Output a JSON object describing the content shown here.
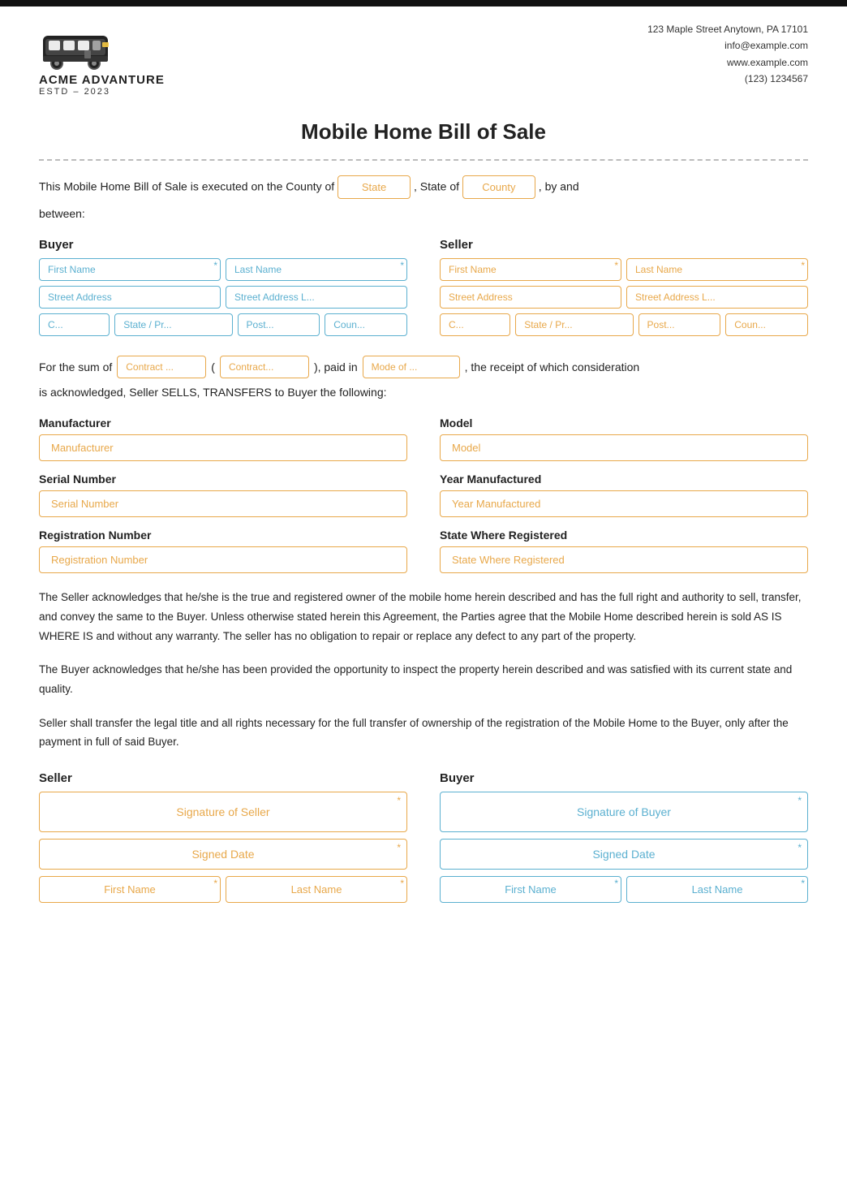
{
  "topbar": {},
  "header": {
    "company_name": "ACME ADVANTURE",
    "company_estd": "ESTD – 2023",
    "contact_address": "123 Maple Street Anytown, PA 17101",
    "contact_email": "info@example.com",
    "contact_website": "www.example.com",
    "contact_phone": "(123) 1234567"
  },
  "document": {
    "title": "Mobile Home Bill of Sale"
  },
  "intro": {
    "text1": "This Mobile Home Bill of Sale is executed on the County of",
    "state_placeholder": "State",
    "text2": ", State of",
    "county_placeholder": "County",
    "text3": ", by and",
    "text4": "between:"
  },
  "buyer": {
    "label": "Buyer",
    "first_name_placeholder": "First Name",
    "last_name_placeholder": "Last Name",
    "street_placeholder": "Street Address",
    "street2_placeholder": "Street Address L...",
    "city_placeholder": "C...",
    "state_placeholder": "State / Pr...",
    "post_placeholder": "Post...",
    "country_placeholder": "Coun..."
  },
  "seller": {
    "label": "Seller",
    "first_name_placeholder": "First Name",
    "last_name_placeholder": "Last Name",
    "street_placeholder": "Street Address",
    "street2_placeholder": "Street Address L...",
    "city_placeholder": "C...",
    "state_placeholder": "State / Pr...",
    "post_placeholder": "Post...",
    "country_placeholder": "Coun..."
  },
  "sum": {
    "text1": "For the sum of",
    "contract1_placeholder": "Contract ...",
    "text2": "(",
    "contract2_placeholder": "Contract...",
    "text3": "), paid in",
    "mode_placeholder": "Mode of ...",
    "text4": ", the receipt of which consideration"
  },
  "ack": {
    "text": "is acknowledged, Seller SELLS, TRANSFERS to Buyer the following:"
  },
  "vehicle": {
    "manufacturer_label": "Manufacturer",
    "manufacturer_placeholder": "Manufacturer",
    "model_label": "Model",
    "model_placeholder": "Model",
    "serial_label": "Serial Number",
    "serial_placeholder": "Serial Number",
    "year_label": "Year Manufactured",
    "year_placeholder": "Year Manufactured",
    "registration_label": "Registration Number",
    "registration_placeholder": "Registration Number",
    "state_reg_label": "State Where Registered",
    "state_reg_placeholder": "State Where Registered"
  },
  "legal": {
    "para1": "The Seller acknowledges that he/she is the true and registered owner of the mobile home herein described and has the full right and authority to sell, transfer, and convey the same to the Buyer. Unless otherwise stated herein this Agreement, the Parties agree that the Mobile Home described herein is sold AS IS WHERE IS and without any warranty. The seller has no obligation to repair or replace any defect to any part of the property.",
    "para2": "The Buyer acknowledges that he/she has been provided the opportunity to inspect the property herein described and was satisfied with its current state and quality.",
    "para3": "Seller shall transfer the legal title and all rights necessary for the full transfer of ownership of the registration of the Mobile Home to the Buyer, only after the payment in full of said Buyer."
  },
  "sig_seller": {
    "label": "Seller",
    "sig_placeholder": "Signature of Seller",
    "date_placeholder": "Signed Date",
    "first_name_placeholder": "First Name",
    "last_name_placeholder": "Last Name"
  },
  "sig_buyer": {
    "label": "Buyer",
    "sig_placeholder": "Signature of Buyer",
    "date_placeholder": "Signed Date",
    "first_name_placeholder": "First Name",
    "last_name_placeholder": "Last Name"
  }
}
